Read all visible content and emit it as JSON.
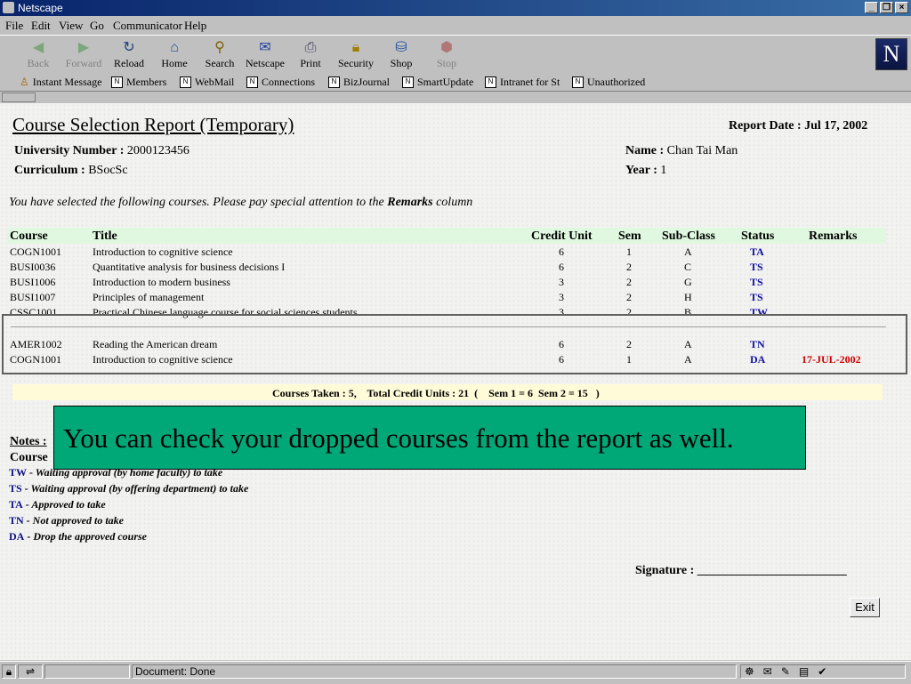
{
  "window": {
    "title": "Netscape"
  },
  "menu": [
    "File",
    "Edit",
    "View",
    "Go",
    "Communicator",
    "Help"
  ],
  "toolbar": [
    {
      "label": "Back",
      "icon": "back-arrow-icon",
      "enabled": false
    },
    {
      "label": "Forward",
      "icon": "forward-arrow-icon",
      "enabled": false
    },
    {
      "label": "Reload",
      "icon": "reload-icon",
      "enabled": true
    },
    {
      "label": "Home",
      "icon": "home-icon",
      "enabled": true
    },
    {
      "label": "Search",
      "icon": "search-icon",
      "enabled": true
    },
    {
      "label": "Netscape",
      "icon": "netscape-icon",
      "enabled": true
    },
    {
      "label": "Print",
      "icon": "print-icon",
      "enabled": true
    },
    {
      "label": "Security",
      "icon": "lock-icon",
      "enabled": true
    },
    {
      "label": "Shop",
      "icon": "shop-icon",
      "enabled": true
    },
    {
      "label": "Stop",
      "icon": "stop-icon",
      "enabled": false
    }
  ],
  "personal_toolbar": [
    "Instant Message",
    "Members",
    "WebMail",
    "Connections",
    "BizJournal",
    "SmartUpdate",
    "Intranet for St",
    "Unauthorized"
  ],
  "report": {
    "title": "Course Selection Report (Temporary)",
    "report_date_label": "Report Date : Jul 17, 2002",
    "univ_label": "University Number :",
    "univ_value": "2000123456",
    "curr_label": "Curriculum :",
    "curr_value": "BSocSc",
    "name_label": "Name :",
    "name_value": "Chan Tai Man",
    "year_label": "Year :",
    "year_value": "1",
    "intro_prefix": "You have selected the following courses. Please pay special attention to the",
    "intro_bold": "Remarks",
    "intro_suffix": "column",
    "headers": {
      "course": "Course",
      "title": "Title",
      "credit": "Credit Unit",
      "sem": "Sem",
      "subclass": "Sub-Class",
      "status": "Status",
      "remarks": "Remarks"
    },
    "rows": [
      {
        "course": "COGN1001",
        "title": "Introduction to cognitive science",
        "credit": "6",
        "sem": "1",
        "subclass": "A",
        "status": "TA",
        "remarks": ""
      },
      {
        "course": "BUSI0036",
        "title": "Quantitative analysis for business decisions I",
        "credit": "6",
        "sem": "2",
        "subclass": "C",
        "status": "TS",
        "remarks": ""
      },
      {
        "course": "BUSI1006",
        "title": "Introduction to modern business",
        "credit": "3",
        "sem": "2",
        "subclass": "G",
        "status": "TS",
        "remarks": ""
      },
      {
        "course": "BUSI1007",
        "title": "Principles of management",
        "credit": "3",
        "sem": "2",
        "subclass": "H",
        "status": "TS",
        "remarks": ""
      },
      {
        "course": "CSSC1001",
        "title": "Practical Chinese language course for social sciences students",
        "credit": "3",
        "sem": "2",
        "subclass": "B",
        "status": "TW",
        "remarks": ""
      }
    ],
    "dropped_rows": [
      {
        "course": "AMER1002",
        "title": "Reading the American dream",
        "credit": "6",
        "sem": "2",
        "subclass": "A",
        "status": "TN",
        "remarks": ""
      },
      {
        "course": "COGN1001",
        "title": "Introduction to cognitive science",
        "credit": "6",
        "sem": "1",
        "subclass": "A",
        "status": "DA",
        "remarks": "17-JUL-2002"
      }
    ],
    "summary": "Courses Taken : 5,    Total Credit Units : 21  (    Sem 1 = 6  Sem 2 = 15   )",
    "notes_label": "Notes :",
    "course_label": "Course",
    "legend": [
      {
        "code": "TW",
        "text": "- Waiting approval (by home faculty) to take"
      },
      {
        "code": "TS",
        "text": "- Waiting approval (by offering department) to take"
      },
      {
        "code": "TA",
        "text": "- Approved to take"
      },
      {
        "code": "TN",
        "text": "- Not approved to take"
      },
      {
        "code": "DA",
        "text": "- Drop the approved course"
      }
    ],
    "signature_label": "Signature : ________________________",
    "exit_label": "Exit"
  },
  "overlay_text": "You can check your dropped courses from the report as well.",
  "status": {
    "text": "Document: Done"
  },
  "colors": {
    "header_row": "#e0f8e0",
    "summary_bg": "#fffbd8",
    "overlay_bg": "#00a878",
    "status_code": "#1010a0",
    "remarks_red": "#cc0000"
  }
}
